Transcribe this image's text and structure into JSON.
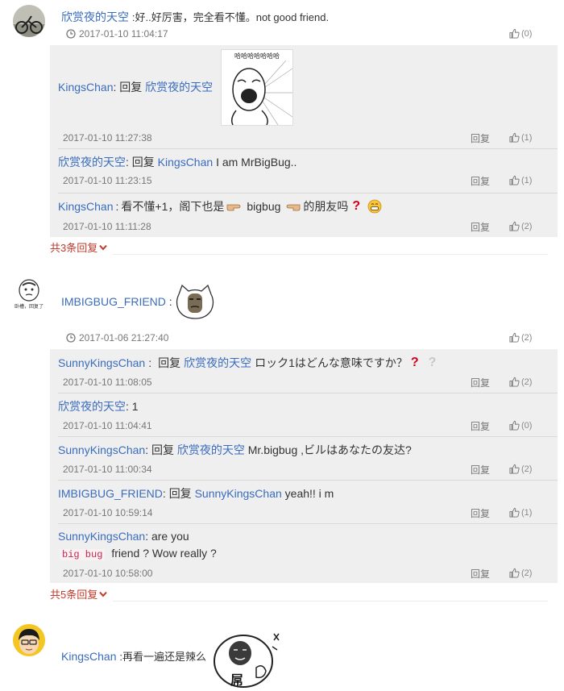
{
  "comments": [
    {
      "author": "欣赏夜的天空",
      "text": ":好..好厉害，完全看不懂。not good friend.",
      "time": "2017-01-10 11:04:17",
      "likes": "(0)",
      "replies": [
        {
          "author": "KingsChan",
          "sep": ":",
          "prefix": "回复",
          "target": "欣赏夜的天空",
          "text": "",
          "sticker": "哈哈哈哈哈哈哈",
          "time": "2017-01-10 11:27:38",
          "reply_label": "回复",
          "likes": "(1)"
        },
        {
          "author": "欣赏夜的天空",
          "sep": ":",
          "prefix": "回复",
          "target": "KingsChan",
          "text": "I am MrBigBug..",
          "time": "2017-01-10 11:23:15",
          "reply_label": "回复",
          "likes": "(1)"
        },
        {
          "author": "KingsChan",
          "sep": ":",
          "text_a": "看不懂+1，阁下也是",
          "text_b": "bigbug",
          "text_c": "的朋友吗",
          "time": "2017-01-10 11:11:28",
          "reply_label": "回复",
          "likes": "(2)"
        }
      ],
      "expand_label": "共3条回复"
    },
    {
      "author": "IMBIGBUG_FRIEND",
      "text": ":",
      "avatar_caption": "卧槽，回复了",
      "time": "2017-01-06 21:27:40",
      "likes": "(2)",
      "replies": [
        {
          "author": "SunnyKingsChan",
          "sep": ":",
          "prefix": "回复",
          "target": "欣赏夜的天空",
          "text": "ロック1はどんな意味ですか？",
          "time": "2017-01-10 11:08:05",
          "reply_label": "回复",
          "likes": "(2)"
        },
        {
          "author": "欣赏夜的天空",
          "sep": ":",
          "text": "1",
          "time": "2017-01-10 11:04:41",
          "reply_label": "回复",
          "likes": "(0)"
        },
        {
          "author": "SunnyKingsChan",
          "sep": ":",
          "prefix": "回复",
          "target": "欣赏夜的天空",
          "text": "Mr.bigbug ,ビルはあなたの友达?",
          "time": "2017-01-10 11:00:34",
          "reply_label": "回复",
          "likes": "(2)"
        },
        {
          "author": "IMBIGBUG_FRIEND",
          "sep": ":",
          "prefix": "回复",
          "target": "SunnyKingsChan",
          "text": "yeah!! i m",
          "time": "2017-01-10 10:59:14",
          "reply_label": "回复",
          "likes": "(1)"
        },
        {
          "author": "SunnyKingsChan",
          "sep": ":",
          "text": "are you",
          "code": "big bug",
          "text2": "friend ? Wow really ?",
          "time": "2017-01-10 10:58:00",
          "reply_label": "回复",
          "likes": "(2)"
        }
      ],
      "expand_label": "共5条回复"
    },
    {
      "author": "KingsChan",
      "text": ":再看一遍还是辣么",
      "sticker_text": "屌"
    }
  ],
  "colors": {
    "link": "#3a6cbd",
    "expand": "#c0392b",
    "panel": "#efefef"
  }
}
